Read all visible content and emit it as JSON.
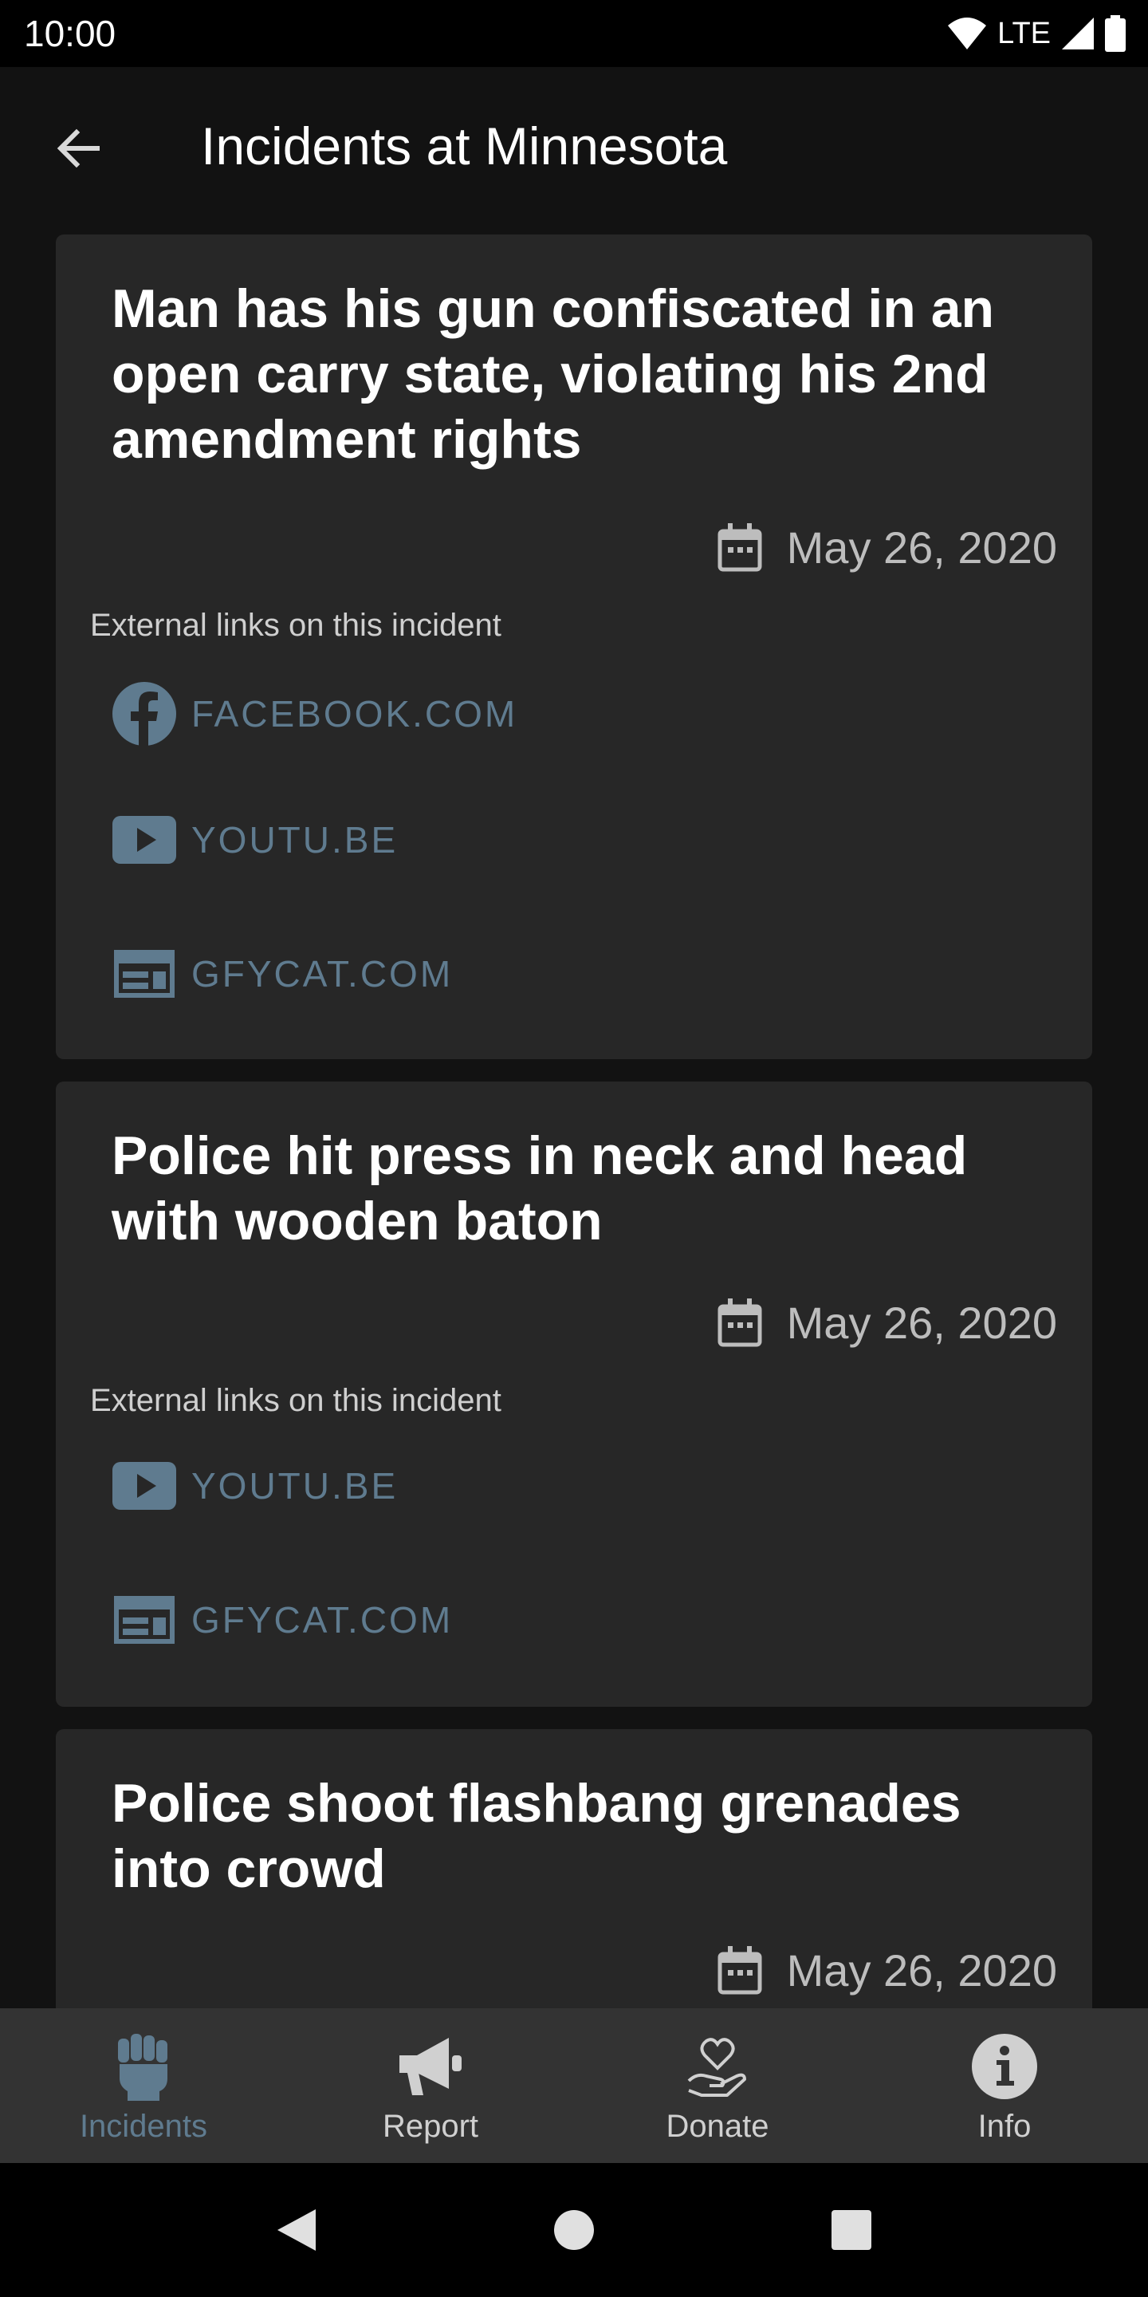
{
  "status_bar": {
    "time": "10:00",
    "network": "LTE"
  },
  "app_bar": {
    "title": "Incidents at Minnesota"
  },
  "colors": {
    "accent": "#5f7b8f",
    "card": "#272727",
    "background": "#121212"
  },
  "incidents": [
    {
      "title": "Man has his gun confiscated in an open carry state, violating his 2nd amendment rights",
      "date": "May 26, 2020",
      "links_label": "External links on this incident",
      "links": [
        {
          "icon": "facebook-icon",
          "label": "FACEBOOK.COM"
        },
        {
          "icon": "youtube-icon",
          "label": "YOUTU.BE"
        },
        {
          "icon": "web-icon",
          "label": "GFYCAT.COM"
        }
      ]
    },
    {
      "title": "Police hit press in neck and head with wooden baton",
      "date": "May 26, 2020",
      "links_label": "External links on this incident",
      "links": [
        {
          "icon": "youtube-icon",
          "label": "YOUTU.BE"
        },
        {
          "icon": "web-icon",
          "label": "GFYCAT.COM"
        }
      ]
    },
    {
      "title": "Police shoot flashbang grenades into crowd",
      "date": "May 26, 2020"
    }
  ],
  "bottom_nav": [
    {
      "icon": "fist-icon",
      "label": "Incidents",
      "active": true
    },
    {
      "icon": "megaphone-icon",
      "label": "Report",
      "active": false
    },
    {
      "icon": "heart-hand-icon",
      "label": "Donate",
      "active": false
    },
    {
      "icon": "info-icon",
      "label": "Info",
      "active": false
    }
  ]
}
